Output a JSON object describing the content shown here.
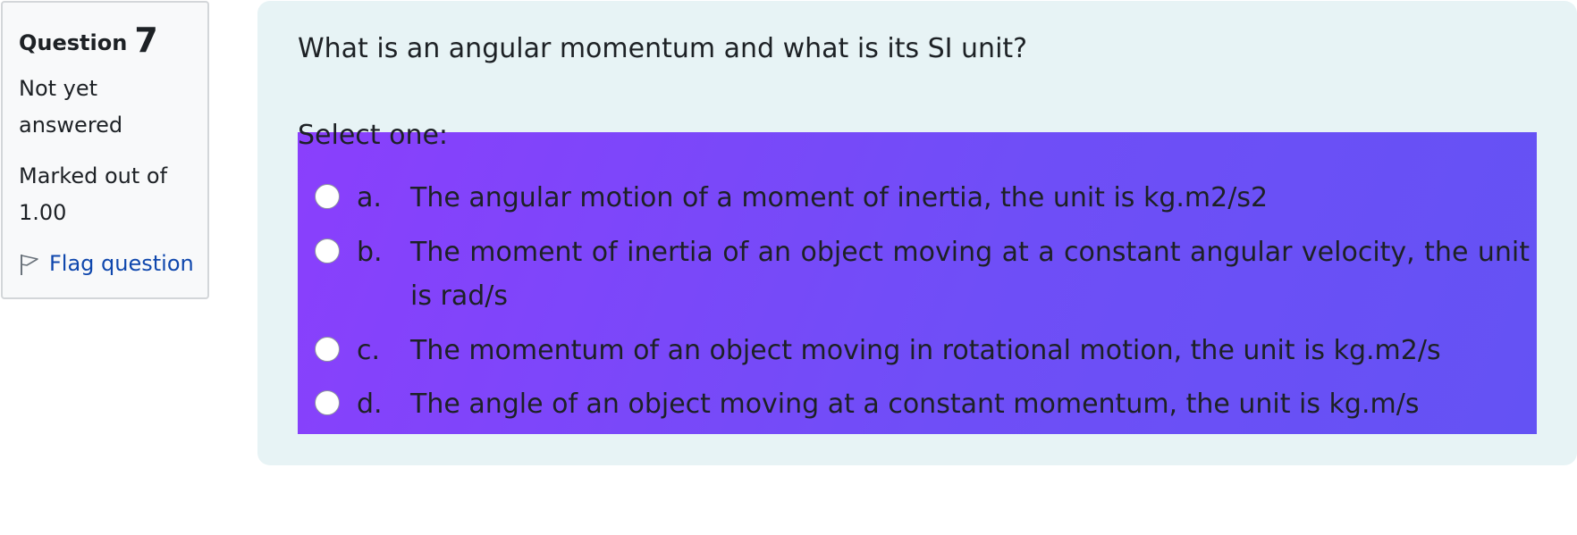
{
  "info": {
    "question_label": "Question",
    "question_number": "7",
    "state": "Not yet answered",
    "grade": "Marked out of 1.00",
    "flag_label": "Flag question"
  },
  "question": {
    "text": "What is an angular momentum and what is its SI unit?",
    "prompt": "Select one:",
    "options": [
      {
        "letter": "a.",
        "text": "The angular motion of a moment of inertia, the unit is kg.m2/s2"
      },
      {
        "letter": "b.",
        "text": "The moment of inertia of an object moving at a constant angular velocity, the unit is rad/s"
      },
      {
        "letter": "c.",
        "text": "The momentum of an object moving in rotational motion, the unit is kg.m2/s"
      },
      {
        "letter": "d.",
        "text": "The angle of an object moving at a constant momentum, the unit is kg.m/s"
      }
    ]
  },
  "colors": {
    "link": "#0f47ad",
    "content_bg": "#e7f3f5",
    "highlight_start": "#8a3ffc",
    "highlight_end": "#6452f4"
  }
}
